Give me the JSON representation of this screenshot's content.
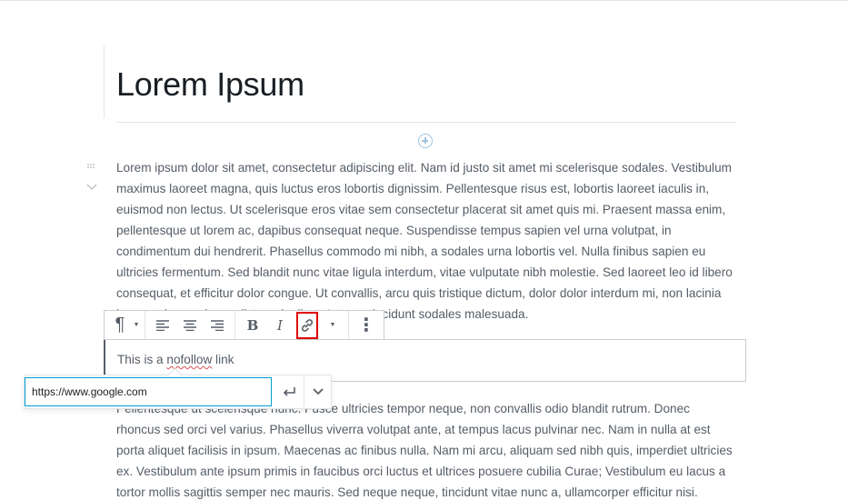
{
  "post": {
    "title": "Lorem Ipsum"
  },
  "paragraph1": "Lorem ipsum dolor sit amet, consectetur adipiscing elit. Nam id justo sit amet mi scelerisque sodales. Vestibulum maximus laoreet magna, quis luctus eros lobortis dignissim. Pellentesque risus est, lobortis laoreet iaculis in, euismod non lectus. Ut scelerisque eros vitae sem consectetur placerat sit amet quis mi. Praesent massa enim, pellentesque ut lorem ac, dapibus consequat neque. Suspendisse tempus sapien vel urna volutpat, in condimentum dui hendrerit. Phasellus commodo mi nibh, a sodales urna lobortis vel. Nulla finibus sapien eu ultricies fermentum. Sed blandit nunc vitae ligula interdum, vitae vulputate nibh molestie. Sed laoreet leo id libero consequat, et efficitur dolor congue. Ut convallis, arcu quis tristique dictum, dolor dolor interdum mi, non lacinia lorem enim non lacus dictum dapibus. Integer tincidunt sodales malesuada.",
  "selected_block": {
    "text_before": "This is a ",
    "text_link": "nofollow",
    "text_after": " link"
  },
  "paragraph3": "Pellentesque ut scelerisque nunc. Fusce ultricies tempor neque, non convallis odio blandit rutrum. Donec rhoncus sed orci vel varius. Phasellus viverra volutpat ante, at tempus lacus pulvinar nec. Nam in nulla at est porta aliquet facilisis in ipsum. Maecenas ac finibus nulla. Nam mi arcu, aliquam sed nibh quis, imperdiet ultricies ex. Vestibulum ante ipsum primis in faucibus orci luctus et ultrices posuere cubilia Curae; Vestibulum eu lacus a tortor mollis sagittis semper nec mauris. Sed neque neque, tincidunt vitae nunc a, ullamcorper efficitur nisi.",
  "toolbar": {
    "paragraph_glyph": "¶",
    "bold_label": "B",
    "italic_label": "I",
    "more_glyph": "⋮"
  },
  "link_popover": {
    "url": "https://www.google.com"
  },
  "icons": {
    "inserter": "plus-circle-icon",
    "drag": "drag-handle-icon",
    "mover": "chevron-down-icon",
    "paragraph": "paragraph-icon",
    "align_left": "align-left-icon",
    "align_center": "align-center-icon",
    "align_right": "align-right-icon",
    "link": "link-icon",
    "submit": "enter-arrow-icon",
    "settings": "chevron-down-icon"
  },
  "colors": {
    "text": "#555d66",
    "heading": "#191e23",
    "highlight": "#e00000",
    "focus": "#00a0d2"
  }
}
